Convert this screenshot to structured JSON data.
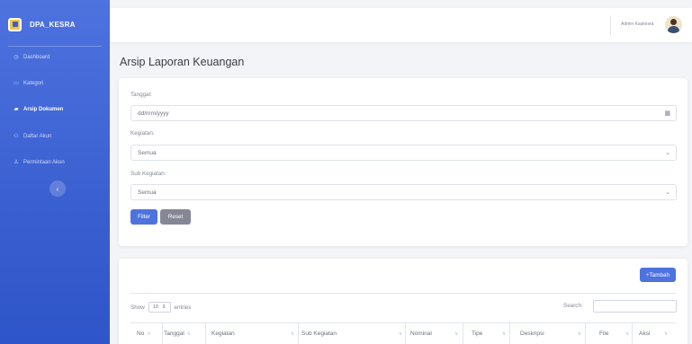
{
  "brand": {
    "name": "DPA_KESRA"
  },
  "sidebar": {
    "items": [
      {
        "label": "Dashboard",
        "icon": "dashboard-icon"
      },
      {
        "label": "Kategori",
        "icon": "folder-icon"
      },
      {
        "label": "Arsip Dokumen",
        "icon": "folder-open-icon",
        "active": true
      },
      {
        "label": "Daftar Akun",
        "icon": "users-icon"
      },
      {
        "label": "Permintaan Akun",
        "icon": "user-icon"
      }
    ],
    "collapse_glyph": "‹"
  },
  "topbar": {
    "user_name": "Admin Kaskesra"
  },
  "page": {
    "title": "Arsip Laporan Keuangan"
  },
  "filter": {
    "tanggal_label": "Tanggal:",
    "tanggal_placeholder": "dd/mm/yyyy",
    "kegiatan_label": "Kegiatan:",
    "kegiatan_value": "Semua",
    "subkegiatan_label": "Sub Kegiatan:",
    "subkegiatan_value": "Semua",
    "filter_button": "Filter",
    "reset_button": "Reset"
  },
  "table": {
    "add_button": "+Tambah",
    "show_prefix": "Show",
    "show_value": "10",
    "show_suffix": "entries",
    "search_label": "Search:",
    "columns": [
      "No",
      "Tanggal",
      "Kegiatan",
      "Sub Kegiatan",
      "Nominal",
      "Tipe",
      "Deskripsi",
      "File",
      "Aksi"
    ]
  },
  "colors": {
    "primary": "#4e73df",
    "secondary": "#858796",
    "sidebar": "#3a5fd0"
  }
}
